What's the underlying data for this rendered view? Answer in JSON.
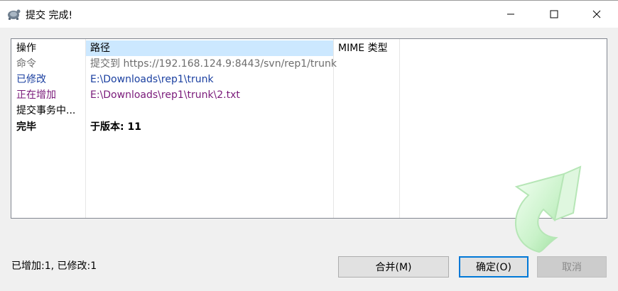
{
  "window": {
    "title": "提交 完成!",
    "controls": {
      "minimize": "minimize-icon",
      "maximize": "maximize-icon",
      "close": "close-icon"
    }
  },
  "table": {
    "columns": [
      "操作",
      "路径",
      "MIME 类型"
    ],
    "rows": [
      {
        "action": "命令",
        "path": "提交到 https://192.168.124.9:8443/svn/rep1/trunk",
        "mime": "",
        "style": "gray"
      },
      {
        "action": "已修改",
        "path": "E:\\Downloads\\rep1\\trunk",
        "mime": "",
        "style": "blue"
      },
      {
        "action": "正在增加",
        "path": "E:\\Downloads\\rep1\\trunk\\2.txt",
        "mime": "",
        "style": "purple"
      },
      {
        "action": "提交事务中...",
        "path": "",
        "mime": "",
        "style": "normal"
      },
      {
        "action": "完毕",
        "path": "于版本: 11",
        "mime": "",
        "style": "bold"
      }
    ]
  },
  "status": {
    "summary": "已增加:1, 已修改:1"
  },
  "buttons": {
    "merge": "合并(M)",
    "ok": "确定(O)",
    "cancel": "取消"
  },
  "colors": {
    "header_highlight": "#cce8ff",
    "modified": "#1a3fa0",
    "added": "#7a1a7a",
    "command": "#6d6d6d",
    "accent": "#0078d7"
  },
  "icons": {
    "app": "tortoise-svn-icon",
    "decoration": "commit-arrow-icon"
  }
}
